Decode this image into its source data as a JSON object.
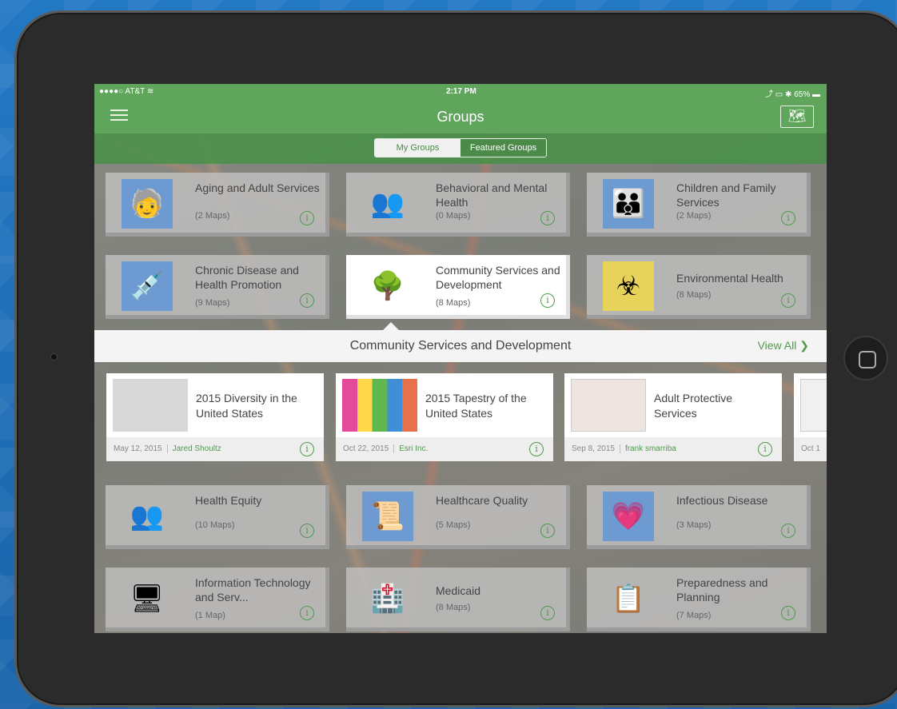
{
  "status": {
    "carrier": "●●●●○ AT&T ≋",
    "time": "2:17 PM",
    "right": "⤴ ▭ ✱ 65% ▬"
  },
  "nav": {
    "title": "Groups",
    "map_icon": "world-map-icon"
  },
  "tabs": [
    {
      "label": "My Groups",
      "active": false
    },
    {
      "label": "Featured Groups",
      "active": true
    }
  ],
  "groups": [
    {
      "name": "Aging and Adult Services",
      "count": "(2 Maps)",
      "icon": "elderly-people-icon"
    },
    {
      "name": "Behavioral and Mental Health",
      "count": "(0 Maps)",
      "icon": "group-people-icon"
    },
    {
      "name": "Children and Family Services",
      "count": "(2 Maps)",
      "icon": "family-icon"
    },
    {
      "name": "Chronic Disease and Health Promotion",
      "count": "(9 Maps)",
      "icon": "syringe-icon"
    },
    {
      "name": "Community Services and Development",
      "count": "(8 Maps)",
      "icon": "park-tree-icon"
    },
    {
      "name": "Environmental Health",
      "count": "(8 Maps)",
      "icon": "biohazard-icon"
    },
    {
      "name": "Health Equity",
      "count": "(10 Maps)",
      "icon": "people-heart-icon"
    },
    {
      "name": "Healthcare Quality",
      "count": "(5 Maps)",
      "icon": "certificate-icon"
    },
    {
      "name": "Infectious Disease",
      "count": "(3 Maps)",
      "icon": "heart-monitor-icon"
    },
    {
      "name": "Information Technology and Serv...",
      "count": "(1 Map)",
      "icon": "computer-icon"
    },
    {
      "name": "Medicaid",
      "count": "(8 Maps)",
      "icon": "hospital-icon"
    },
    {
      "name": "Preparedness and Planning",
      "count": "(7 Maps)",
      "icon": "planning-board-icon"
    }
  ],
  "detail": {
    "title": "Community Services and Development",
    "view_all": "View All",
    "maps": [
      {
        "title": "2015 Diversity in the United States",
        "date": "May 12, 2015",
        "owner": "Jared Shoultz"
      },
      {
        "title": "2015 Tapestry of the United States",
        "date": "Oct 22, 2015",
        "owner": "Esri Inc."
      },
      {
        "title": "Adult Protective Services",
        "date": "Sep 8, 2015",
        "owner": "frank smarriba"
      },
      {
        "title": "",
        "date": "Oct 1",
        "owner": ""
      }
    ]
  },
  "info_glyph": "i",
  "colors": {
    "green": "#5fa55c",
    "dark_green": "#4b8a48",
    "accent": "#4f9a4c"
  }
}
